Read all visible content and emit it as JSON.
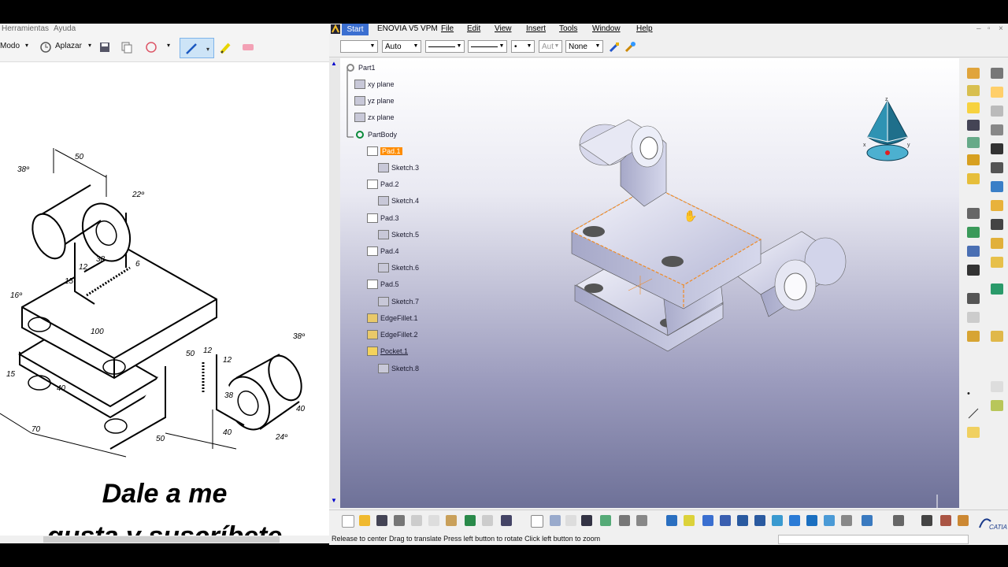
{
  "left_window": {
    "menu": [
      "Herramientas",
      "Ayuda"
    ],
    "toolbar": {
      "mode_label": "Modo",
      "delay_label": "Aplazar"
    },
    "drawing_dims": [
      "50",
      "38º",
      "22º",
      "38",
      "6",
      "12",
      "15",
      "16º",
      "100",
      "40",
      "50",
      "12",
      "15",
      "70",
      "50",
      "38º",
      "12",
      "38",
      "40",
      "40",
      "24º"
    ],
    "caption_line1": "Dale a me",
    "caption_line2": "gusta y suscríbete"
  },
  "catia": {
    "menu": {
      "start": "Start",
      "items": [
        "ENOVIA V5 VPM",
        "File",
        "Edit",
        "View",
        "Insert",
        "Tools",
        "Window",
        "Help"
      ]
    },
    "graphic_props": {
      "color": "",
      "transparency": "Auto",
      "layer_value": "Aut",
      "layer": "None",
      "point": "•"
    },
    "tree": [
      {
        "label": "Part1",
        "icon": "part-icon"
      },
      {
        "label": "xy plane",
        "icon": "plane-icon"
      },
      {
        "label": "yz plane",
        "icon": "plane-icon"
      },
      {
        "label": "zx plane",
        "icon": "plane-icon"
      },
      {
        "label": "PartBody",
        "icon": "body-icon"
      },
      {
        "label": "Pad.1",
        "icon": "pad-icon",
        "highlight": true
      },
      {
        "label": "Sketch.3",
        "icon": "sketch-icon"
      },
      {
        "label": "Pad.2",
        "icon": "pad-icon"
      },
      {
        "label": "Sketch.4",
        "icon": "sketch-icon"
      },
      {
        "label": "Pad.3",
        "icon": "pad-icon"
      },
      {
        "label": "Sketch.5",
        "icon": "sketch-icon"
      },
      {
        "label": "Pad.4",
        "icon": "pad-icon"
      },
      {
        "label": "Sketch.6",
        "icon": "sketch-icon"
      },
      {
        "label": "Pad.5",
        "icon": "pad-icon"
      },
      {
        "label": "Sketch.7",
        "icon": "sketch-icon"
      },
      {
        "label": "EdgeFillet.1",
        "icon": "fillet-icon"
      },
      {
        "label": "EdgeFillet.2",
        "icon": "fillet-icon"
      },
      {
        "label": "Pocket.1",
        "icon": "pocket-icon",
        "underline": true
      },
      {
        "label": "Sketch.8",
        "icon": "sketch-icon"
      }
    ],
    "compass_axes": [
      "z",
      "x",
      "y"
    ],
    "status_text": "Release to center  Drag to translate  Press left button to rotate  Click left button to zoom",
    "logo": "CATIA",
    "colors": {
      "highlight": "#ff8c00",
      "selection": "#f08a24",
      "part_face": "#c9cbe3",
      "start": "#3b6fd1"
    }
  }
}
